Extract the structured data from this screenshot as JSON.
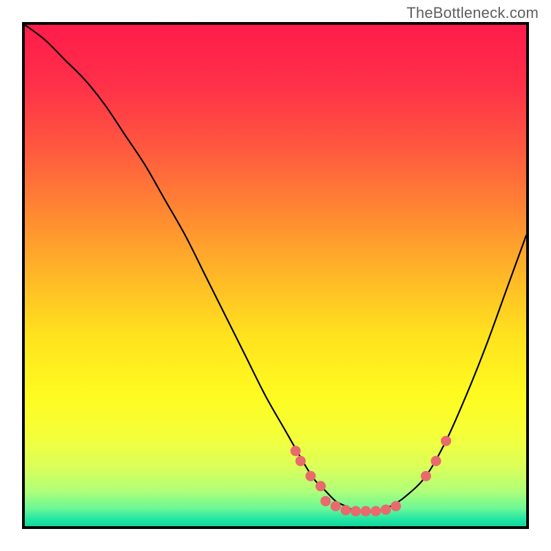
{
  "watermark": "TheBottleneck.com",
  "chart_data": {
    "type": "line",
    "title": "",
    "xlabel": "",
    "ylabel": "",
    "xlim": [
      0,
      100
    ],
    "ylim": [
      0,
      100
    ],
    "gradient": {
      "orientation": "vertical",
      "stops": [
        {
          "offset": 0.0,
          "color": "#ff1c4b"
        },
        {
          "offset": 0.12,
          "color": "#ff3049"
        },
        {
          "offset": 0.25,
          "color": "#ff5a3f"
        },
        {
          "offset": 0.38,
          "color": "#ff8a32"
        },
        {
          "offset": 0.5,
          "color": "#ffb727"
        },
        {
          "offset": 0.62,
          "color": "#ffe21e"
        },
        {
          "offset": 0.74,
          "color": "#fffb20"
        },
        {
          "offset": 0.82,
          "color": "#f4ff3a"
        },
        {
          "offset": 0.88,
          "color": "#dcff59"
        },
        {
          "offset": 0.93,
          "color": "#b0ff78"
        },
        {
          "offset": 0.965,
          "color": "#6bf796"
        },
        {
          "offset": 0.985,
          "color": "#24e7a4"
        },
        {
          "offset": 1.0,
          "color": "#11d79b"
        }
      ]
    },
    "series": [
      {
        "name": "bottleneck-curve",
        "x": [
          0,
          4,
          8,
          12,
          16,
          20,
          24,
          28,
          32,
          36,
          40,
          44,
          48,
          52,
          56,
          58,
          60,
          62,
          64,
          66,
          68,
          70,
          73,
          76,
          80,
          84,
          88,
          92,
          96,
          100
        ],
        "y": [
          100,
          97,
          93,
          89,
          84,
          78,
          72,
          65,
          58,
          50,
          42,
          34,
          26,
          19,
          12,
          9,
          7,
          5,
          4,
          3,
          3,
          3,
          4,
          6,
          10,
          17,
          26,
          36,
          47,
          58
        ]
      }
    ],
    "markers": {
      "name": "highlight-dots",
      "color": "#e86a6d",
      "points": [
        {
          "x": 54,
          "y": 15
        },
        {
          "x": 55,
          "y": 13
        },
        {
          "x": 57,
          "y": 10
        },
        {
          "x": 59,
          "y": 8
        },
        {
          "x": 60,
          "y": 5
        },
        {
          "x": 62,
          "y": 4
        },
        {
          "x": 64,
          "y": 3.2
        },
        {
          "x": 66,
          "y": 3
        },
        {
          "x": 68,
          "y": 3
        },
        {
          "x": 70,
          "y": 3
        },
        {
          "x": 72,
          "y": 3.3
        },
        {
          "x": 74,
          "y": 4
        },
        {
          "x": 80,
          "y": 10
        },
        {
          "x": 82,
          "y": 13
        },
        {
          "x": 84,
          "y": 17
        }
      ]
    }
  }
}
